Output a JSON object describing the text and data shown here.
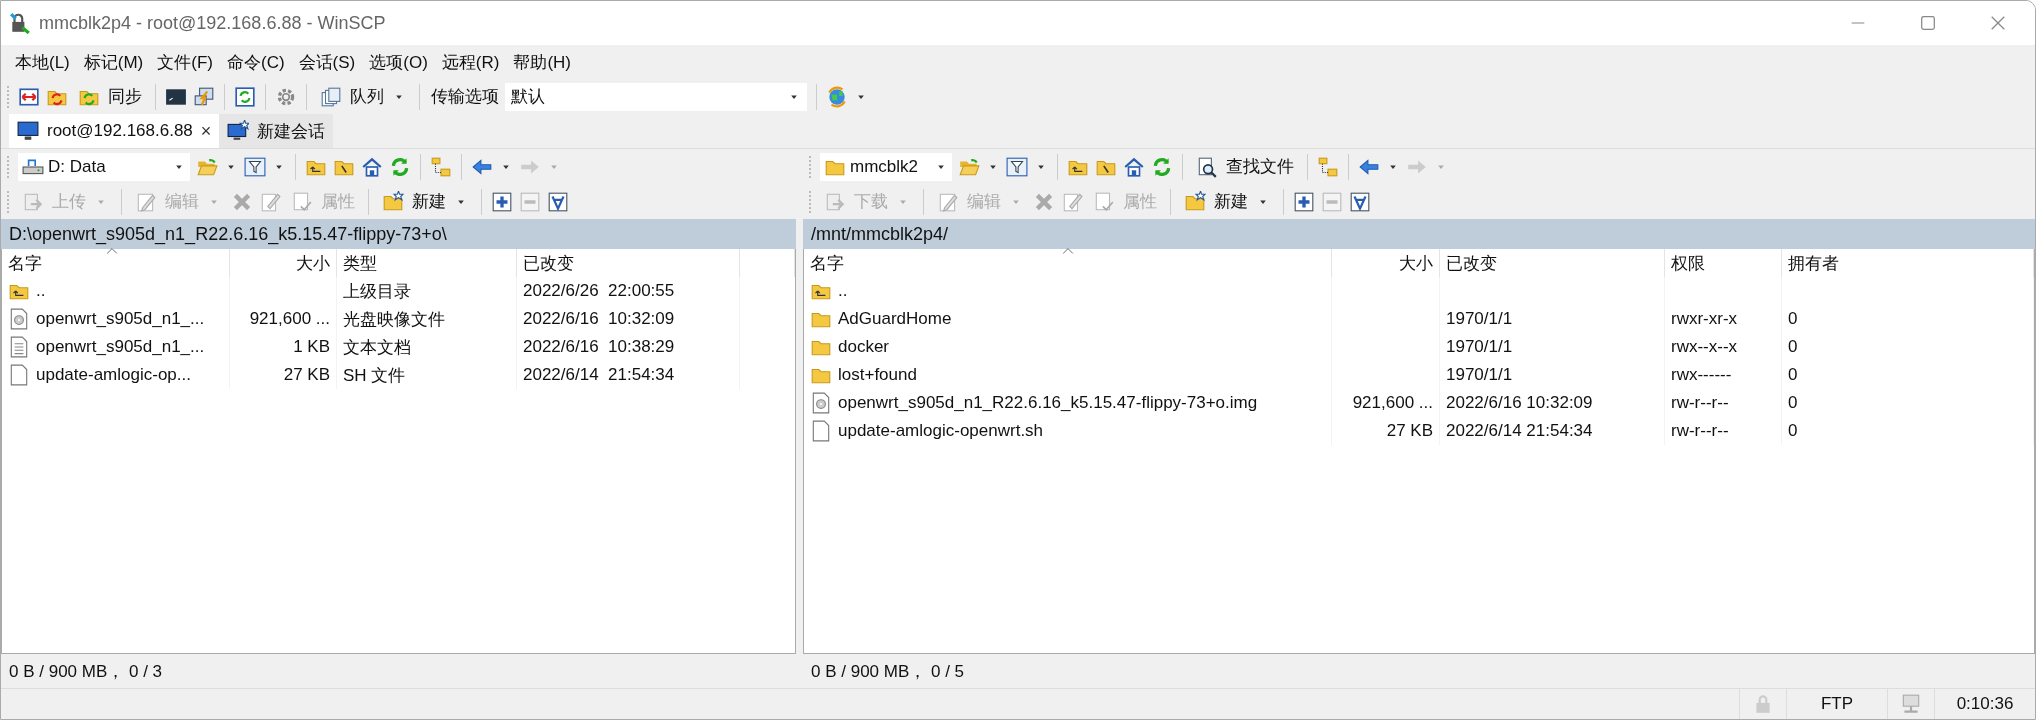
{
  "window": {
    "title": "mmcblk2p4 - root@192.168.6.88 - WinSCP"
  },
  "menu": [
    "本地(L)",
    "标记(M)",
    "文件(F)",
    "命令(C)",
    "会话(S)",
    "选项(O)",
    "远程(R)",
    "帮助(H)"
  ],
  "toolbar": {
    "sync_label": "同步",
    "queue_label": "队列",
    "transfer_label": "传输选项",
    "transfer_value": "默认"
  },
  "tabs": [
    {
      "label": "root@192.168.6.88",
      "close": "×",
      "selected": true,
      "kind": "session"
    },
    {
      "label": "新建会话",
      "selected": false,
      "kind": "new"
    }
  ],
  "panels": [
    {
      "location": {
        "label": "D: Data",
        "kind": "drive"
      },
      "transfer_button": {
        "label": "上传",
        "disabled": true
      },
      "edit_button": {
        "label": "编辑",
        "disabled": true
      },
      "properties_button": {
        "label": "属性",
        "disabled": true
      },
      "new_button": {
        "label": "新建",
        "disabled": false
      },
      "path": "D:\\openwrt_s905d_n1_R22.6.16_k5.15.47-flippy-73+o\\",
      "columns": [
        {
          "label": "名字",
          "kind": "name"
        },
        {
          "label": "大小",
          "kind": "size"
        },
        {
          "label": "类型",
          "kind": "text"
        },
        {
          "label": "已改变",
          "kind": "text"
        },
        {
          "kind": "filler"
        }
      ],
      "rows": [
        {
          "kind": "parent",
          "cells": [
            "..",
            "",
            "上级目录",
            "2022/6/26  22:00:55"
          ]
        },
        {
          "kind": "disc",
          "cells": [
            "openwrt_s905d_n1_...",
            "921,600 ...",
            "光盘映像文件",
            "2022/6/16  10:32:09"
          ]
        },
        {
          "kind": "text",
          "cells": [
            "openwrt_s905d_n1_...",
            "1 KB",
            "文本文档",
            "2022/6/16  10:38:29"
          ]
        },
        {
          "kind": "file",
          "cells": [
            "update-amlogic-op...",
            "27 KB",
            "SH 文件",
            "2022/6/14  21:54:34"
          ]
        }
      ],
      "status": "0 B / 900 MB，  0 / 3"
    },
    {
      "location": {
        "label": "mmcblk2",
        "kind": "folder"
      },
      "find_button": "查找文件",
      "transfer_button": {
        "label": "下载",
        "disabled": true
      },
      "edit_button": {
        "label": "编辑",
        "disabled": true
      },
      "properties_button": {
        "label": "属性",
        "disabled": true
      },
      "new_button": {
        "label": "新建",
        "disabled": false
      },
      "path": "/mnt/mmcblk2p4/",
      "columns": [
        {
          "label": "名字",
          "kind": "name"
        },
        {
          "label": "大小",
          "kind": "size"
        },
        {
          "label": "已改变",
          "kind": "text"
        },
        {
          "label": "权限",
          "kind": "text"
        },
        {
          "label": "拥有者",
          "kind": "text"
        }
      ],
      "rows": [
        {
          "kind": "parent",
          "cells": [
            "..",
            "",
            "",
            "",
            ""
          ]
        },
        {
          "kind": "folder",
          "cells": [
            "AdGuardHome",
            "",
            "1970/1/1",
            "rwxr-xr-x",
            "0"
          ]
        },
        {
          "kind": "folder",
          "cells": [
            "docker",
            "",
            "1970/1/1",
            "rwx--x--x",
            "0"
          ]
        },
        {
          "kind": "folder",
          "cells": [
            "lost+found",
            "",
            "1970/1/1",
            "rwx------",
            "0"
          ]
        },
        {
          "kind": "disc",
          "cells": [
            "openwrt_s905d_n1_R22.6.16_k5.15.47-flippy-73+o.img",
            "921,600 ...",
            "2022/6/16 10:32:09",
            "rw-r--r--",
            "0"
          ]
        },
        {
          "kind": "file",
          "cells": [
            "update-amlogic-openwrt.sh",
            "27 KB",
            "2022/6/14 21:54:34",
            "rw-r--r--",
            "0"
          ]
        }
      ],
      "status": "0 B / 900 MB，  0 / 5"
    }
  ],
  "status_bar": {
    "protocol": "FTP",
    "elapsed": "0:10:36"
  }
}
